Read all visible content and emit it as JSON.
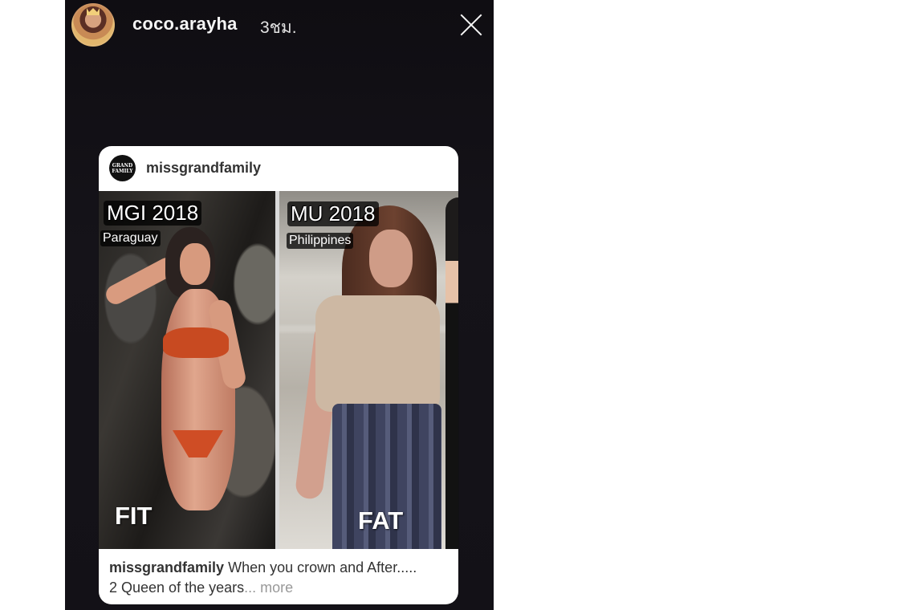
{
  "story": {
    "username": "coco.arayha",
    "time": "3ชม.",
    "close_icon": "close-icon"
  },
  "post": {
    "username": "missgrandfamily",
    "brand_text": "GRAND FAMILY",
    "left_photo": {
      "title": "MGI 2018",
      "country": "Paraguay",
      "word": "FIT"
    },
    "right_photo": {
      "title": "MU 2018",
      "country": "Philippines",
      "word": "FAT"
    },
    "caption_user": "missgrandfamily",
    "caption_text": "When you crown and After.....",
    "caption_line2": "2 Queen of the years",
    "more": "... more"
  },
  "colors": {
    "story_bg": "#131117",
    "card_bg": "#ffffff",
    "text": "#333333",
    "muted": "#999999"
  }
}
